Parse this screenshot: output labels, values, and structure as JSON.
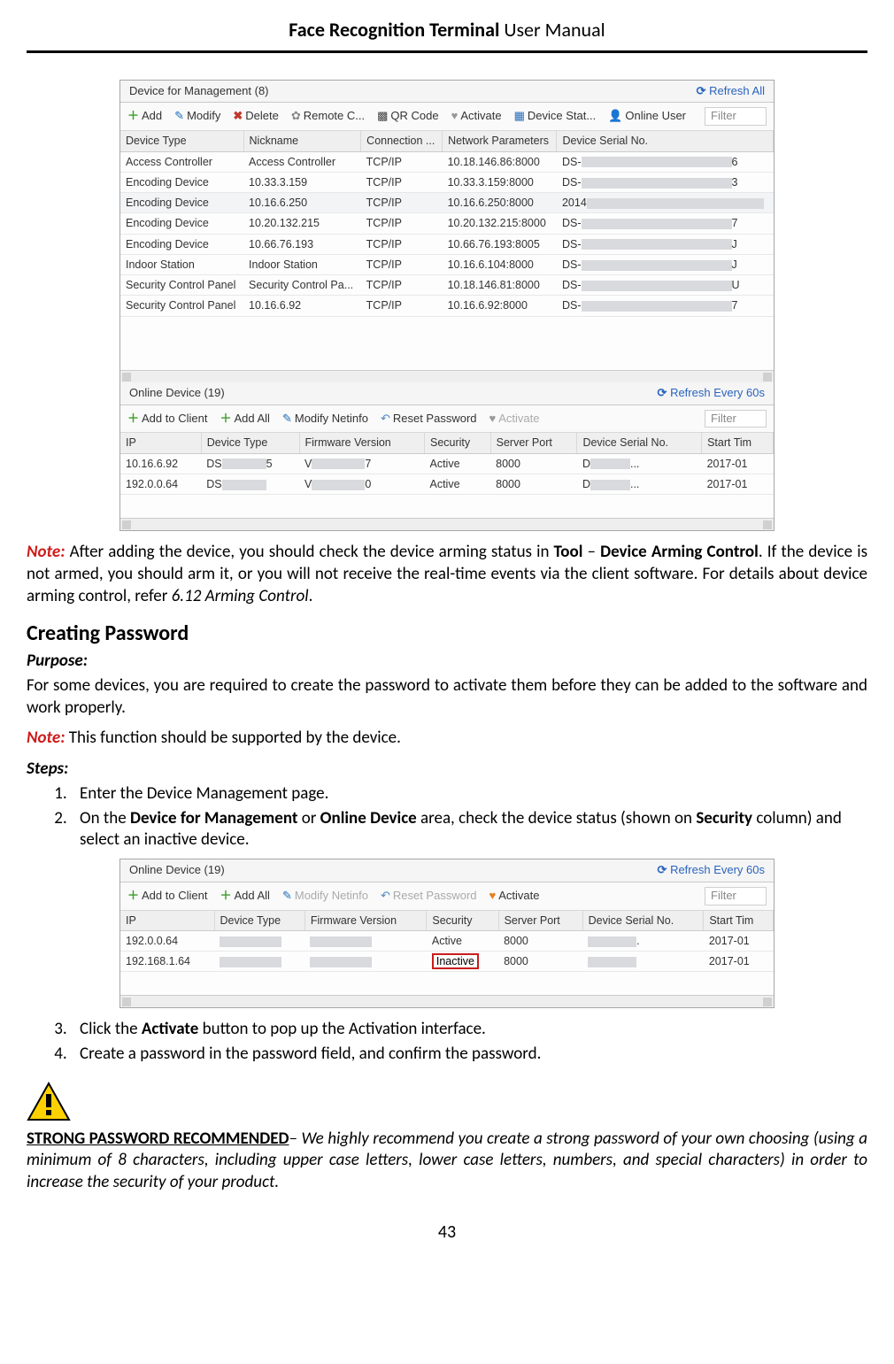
{
  "header": {
    "title_bold": "Face Recognition Terminal",
    "title_light": " User Manual"
  },
  "screenshot1": {
    "panel_title": "Device for Management (8)",
    "refresh": "Refresh All",
    "toolbar": {
      "add": "Add",
      "modify": "Modify",
      "delete": "Delete",
      "remote": "Remote C...",
      "qr": "QR Code",
      "activate": "Activate",
      "devstat": "Device Stat...",
      "online": "Online User",
      "filter": "Filter"
    },
    "headers": [
      "Device Type",
      "Nickname",
      "Connection ...",
      "Network Parameters",
      "Device Serial No."
    ],
    "rows": [
      {
        "type": "Access Controller",
        "nick": "Access Controller",
        "conn": "TCP/IP",
        "net": "10.18.146.86:8000",
        "serial_pre": "DS-",
        "serial_suf": "6"
      },
      {
        "type": "Encoding Device",
        "nick": "10.33.3.159",
        "conn": "TCP/IP",
        "net": "10.33.3.159:8000",
        "serial_pre": "DS-",
        "serial_suf": "3"
      },
      {
        "type": "Encoding Device",
        "nick": "10.16.6.250",
        "conn": "TCP/IP",
        "net": "10.16.6.250:8000",
        "serial_pre": "2014",
        "serial_suf": "",
        "hl": true
      },
      {
        "type": "Encoding Device",
        "nick": "10.20.132.215",
        "conn": "TCP/IP",
        "net": "10.20.132.215:8000",
        "serial_pre": "DS-",
        "serial_suf": "7"
      },
      {
        "type": "Encoding Device",
        "nick": "10.66.76.193",
        "conn": "TCP/IP",
        "net": "10.66.76.193:8005",
        "serial_pre": "DS-",
        "serial_suf": "J"
      },
      {
        "type": "Indoor Station",
        "nick": "Indoor Station",
        "conn": "TCP/IP",
        "net": "10.16.6.104:8000",
        "serial_pre": "DS-",
        "serial_suf": "J"
      },
      {
        "type": "Security Control Panel",
        "nick": "Security Control Pa...",
        "conn": "TCP/IP",
        "net": "10.18.146.81:8000",
        "serial_pre": "DS-",
        "serial_suf": "U"
      },
      {
        "type": "Security Control Panel",
        "nick": "10.16.6.92",
        "conn": "TCP/IP",
        "net": "10.16.6.92:8000",
        "serial_pre": "DS-",
        "serial_suf": "7"
      }
    ],
    "online_title": "Online Device (19)",
    "online_refresh": "Refresh Every 60s",
    "online_toolbar": {
      "add_client": "Add to Client",
      "add_all": "Add All",
      "modify_net": "Modify Netinfo",
      "reset_pw": "Reset Password",
      "activate": "Activate",
      "filter": "Filter"
    },
    "online_headers": [
      "IP",
      "Device Type",
      "Firmware Version",
      "Security",
      "Server Port",
      "Device Serial No.",
      "Start Tim"
    ],
    "online_rows": [
      {
        "ip": "10.16.6.92",
        "type_pre": "DS",
        "type_suf": "5",
        "fw_pre": "V",
        "fw_suf": "7",
        "sec": "Active",
        "port": "8000",
        "serial_pre": "D",
        "serial_suf": "...",
        "start": "2017-01"
      },
      {
        "ip": "192.0.0.64",
        "type_pre": "DS",
        "type_suf": "",
        "fw_pre": "V",
        "fw_suf": "0",
        "sec": "Active",
        "port": "8000",
        "serial_pre": "D",
        "serial_suf": "...",
        "start": "2017-01"
      }
    ]
  },
  "note1_label": "Note:",
  "note1_body_1": " After adding the device, you should check the device arming status in ",
  "note1_bold_1": "Tool",
  "note1_dash": " – ",
  "note1_bold_2": "Device Arming Control",
  "note1_body_2": ". If the device is not armed, you should arm it, or you will not receive the real-time events via the client software. For details about device arming control, refer ",
  "note1_ref": "6.12 Arming Control",
  "note1_end": ".",
  "section_heading": "Creating Password",
  "purpose_label": "Purpose:",
  "purpose_body": "For some devices, you are required to create the password to activate them before they can be added to the software and work properly.",
  "note2_label": "Note:",
  "note2_body": " This function should be supported by the device.",
  "steps_label": "Steps:",
  "steps": {
    "s1": "Enter the Device Management page.",
    "s2_1": "On the ",
    "s2_b1": "Device for Management",
    "s2_2": " or ",
    "s2_b2": "Online Device",
    "s2_3": " area, check the device status (shown on ",
    "s2_b3": "Security",
    "s2_4": " column) and select an inactive device.",
    "s3_1": "Click the ",
    "s3_b1": "Activate",
    "s3_2": " button to pop up the Activation interface.",
    "s4": "Create a password in the password field, and confirm the password."
  },
  "screenshot2": {
    "title": "Online Device (19)",
    "refresh": "Refresh Every 60s",
    "toolbar": {
      "add_client": "Add to Client",
      "add_all": "Add All",
      "modify_net": "Modify Netinfo",
      "reset_pw": "Reset Password",
      "activate": "Activate",
      "filter": "Filter"
    },
    "headers": [
      "IP",
      "Device Type",
      "Firmware Version",
      "Security",
      "Server Port",
      "Device Serial No.",
      "Start Tim"
    ],
    "rows": [
      {
        "ip": "192.0.0.64",
        "sec": "Active",
        "port": "8000",
        "serial_suf": ".",
        "start": "2017-01"
      },
      {
        "ip": "192.168.1.64",
        "sec": "Inactive",
        "port": "8000",
        "start": "2017-01",
        "inactive": true
      }
    ]
  },
  "strong_pw_heading": "STRONG PASSWORD RECOMMENDED",
  "strong_pw_body": "– We highly recommend you create a strong password of your own choosing (using a minimum of 8 characters, including upper case letters, lower case letters, numbers, and special characters) in order to increase the security of your product.",
  "page_number": "43"
}
